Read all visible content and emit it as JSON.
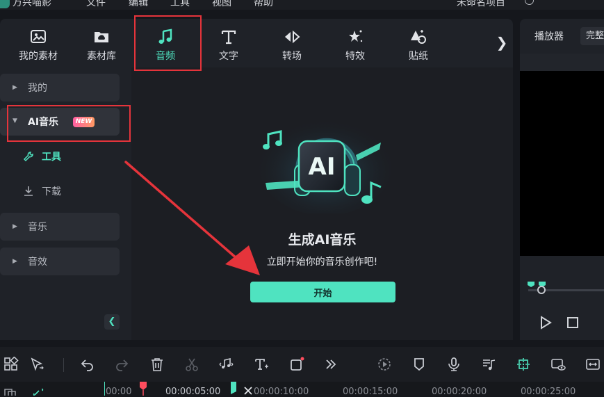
{
  "menu": {
    "app_name": "万兴喵影",
    "items": [
      "文件",
      "编辑",
      "工具",
      "视图",
      "帮助"
    ],
    "project_name": "未命名项目"
  },
  "media_tabs": [
    {
      "label": "我的素材",
      "icon": "media-icon"
    },
    {
      "label": "素材库",
      "icon": "cloud-folder-icon"
    },
    {
      "label": "音频",
      "icon": "music-note-icon",
      "active": true
    },
    {
      "label": "文字",
      "icon": "text-icon"
    },
    {
      "label": "转场",
      "icon": "transition-icon"
    },
    {
      "label": "特效",
      "icon": "effects-icon"
    },
    {
      "label": "贴纸",
      "icon": "sticker-icon"
    }
  ],
  "sidebar": {
    "mine": "我的",
    "ai_music": "AI音乐",
    "new_badge": "NEW",
    "tools": "工具",
    "download": "下载",
    "music": "音乐",
    "sfx": "音效"
  },
  "hero": {
    "title": "生成AI音乐",
    "subtitle": "立即开始你的音乐创作吧!",
    "button": "开始",
    "art_text": "AI"
  },
  "player": {
    "tab": "播放器",
    "quality": "完整"
  },
  "timeline": {
    "timecodes": [
      "00:00",
      "00:00:05:00",
      "00:00:10:00",
      "00:00:15:00",
      "00:00:20:00",
      "00:00:25:00"
    ]
  },
  "colors": {
    "accent": "#4fe3c0",
    "highlight_box": "#e5343b",
    "playhead": "#ff4d5e",
    "new_badge_start": "#ff5fa2",
    "new_badge_end": "#ff9a62"
  }
}
